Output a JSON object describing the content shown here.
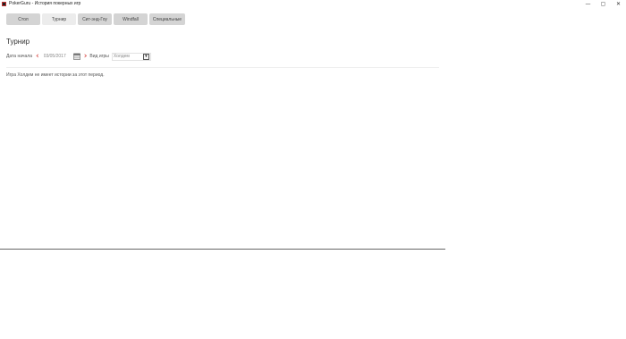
{
  "window": {
    "title": "PokerGuru - История покерных игр",
    "controls": {
      "minimize": "—",
      "maximize": "▢",
      "close": "✕"
    }
  },
  "tabs": [
    {
      "label": "Стол",
      "active": false
    },
    {
      "label": "Турнир",
      "active": true
    },
    {
      "label": "Сит-энд-Гоу",
      "active": false
    },
    {
      "label": "Windfall",
      "active": false
    },
    {
      "label": "Специальные",
      "active": false
    }
  ],
  "page": {
    "title": "Турнир"
  },
  "filters": {
    "start_date_label": "Дата начала",
    "start_date_value": "03/05/2017",
    "game_type_label": "Вид игры",
    "game_type_value": "Холдем"
  },
  "message": "Игра Холдем не имеет истории за этот период.",
  "colors": {
    "accent_arrow": "#d9534f",
    "tab_bg": "#d4d4d4",
    "tab_active_bg": "#ececec"
  }
}
